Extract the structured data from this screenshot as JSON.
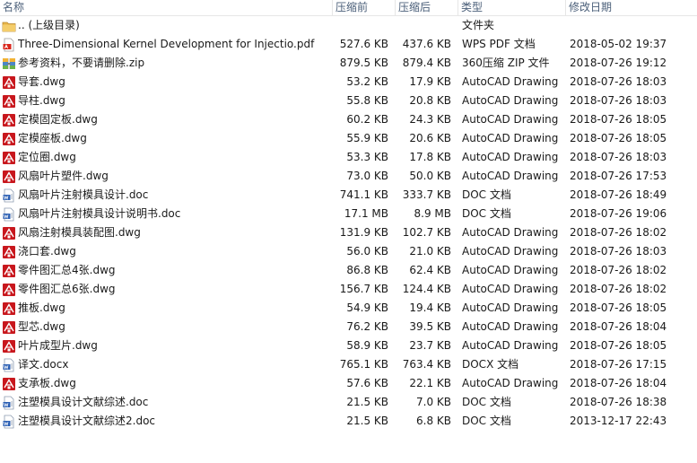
{
  "columns": {
    "name": "名称",
    "compressed": "压缩前",
    "original": "压缩后",
    "type": "类型",
    "modified": "修改日期"
  },
  "rows": [
    {
      "icon": "folder-up-icon",
      "name": ".. (上级目录)",
      "compressed": "",
      "original": "",
      "type": "文件夹",
      "modified": ""
    },
    {
      "icon": "pdf-file-icon",
      "name": "Three-Dimensional Kernel Development for Injectio.pdf",
      "compressed": "527.6 KB",
      "original": "437.6 KB",
      "type": "WPS PDF 文档",
      "modified": "2018-05-02 19:37"
    },
    {
      "icon": "zip-archive-icon",
      "name": "参考资料，不要请删除.zip",
      "compressed": "879.5 KB",
      "original": "879.4 KB",
      "type": "360压缩 ZIP 文件",
      "modified": "2018-07-26 19:12"
    },
    {
      "icon": "dwg-file-icon",
      "name": "导套.dwg",
      "compressed": "53.2 KB",
      "original": "17.9 KB",
      "type": "AutoCAD Drawing",
      "modified": "2018-07-26 18:03"
    },
    {
      "icon": "dwg-file-icon",
      "name": "导柱.dwg",
      "compressed": "55.8 KB",
      "original": "20.8 KB",
      "type": "AutoCAD Drawing",
      "modified": "2018-07-26 18:03"
    },
    {
      "icon": "dwg-file-icon",
      "name": "定模固定板.dwg",
      "compressed": "60.2 KB",
      "original": "24.3 KB",
      "type": "AutoCAD Drawing",
      "modified": "2018-07-26 18:05"
    },
    {
      "icon": "dwg-file-icon",
      "name": "定模座板.dwg",
      "compressed": "55.9 KB",
      "original": "20.6 KB",
      "type": "AutoCAD Drawing",
      "modified": "2018-07-26 18:05"
    },
    {
      "icon": "dwg-file-icon",
      "name": "定位圈.dwg",
      "compressed": "53.3 KB",
      "original": "17.8 KB",
      "type": "AutoCAD Drawing",
      "modified": "2018-07-26 18:03"
    },
    {
      "icon": "dwg-file-icon",
      "name": "风扇叶片塑件.dwg",
      "compressed": "73.0 KB",
      "original": "50.0 KB",
      "type": "AutoCAD Drawing",
      "modified": "2018-07-26 17:53"
    },
    {
      "icon": "doc-file-icon",
      "name": "风扇叶片注射模具设计.doc",
      "compressed": "741.1 KB",
      "original": "333.7 KB",
      "type": "DOC 文档",
      "modified": "2018-07-26 18:49"
    },
    {
      "icon": "doc-file-icon",
      "name": "风扇叶片注射模具设计说明书.doc",
      "compressed": "17.1 MB",
      "original": "8.9 MB",
      "type": "DOC 文档",
      "modified": "2018-07-26 19:06"
    },
    {
      "icon": "dwg-file-icon",
      "name": "风扇注射模具装配图.dwg",
      "compressed": "131.9 KB",
      "original": "102.7 KB",
      "type": "AutoCAD Drawing",
      "modified": "2018-07-26 18:02"
    },
    {
      "icon": "dwg-file-icon",
      "name": "浇口套.dwg",
      "compressed": "56.0 KB",
      "original": "21.0 KB",
      "type": "AutoCAD Drawing",
      "modified": "2018-07-26 18:03"
    },
    {
      "icon": "dwg-file-icon",
      "name": "零件图汇总4张.dwg",
      "compressed": "86.8 KB",
      "original": "62.4 KB",
      "type": "AutoCAD Drawing",
      "modified": "2018-07-26 18:02"
    },
    {
      "icon": "dwg-file-icon",
      "name": "零件图汇总6张.dwg",
      "compressed": "156.7 KB",
      "original": "124.4 KB",
      "type": "AutoCAD Drawing",
      "modified": "2018-07-26 18:02"
    },
    {
      "icon": "dwg-file-icon",
      "name": "推板.dwg",
      "compressed": "54.9 KB",
      "original": "19.4 KB",
      "type": "AutoCAD Drawing",
      "modified": "2018-07-26 18:05"
    },
    {
      "icon": "dwg-file-icon",
      "name": "型芯.dwg",
      "compressed": "76.2 KB",
      "original": "39.5 KB",
      "type": "AutoCAD Drawing",
      "modified": "2018-07-26 18:04"
    },
    {
      "icon": "dwg-file-icon",
      "name": "叶片成型片.dwg",
      "compressed": "58.9 KB",
      "original": "23.7 KB",
      "type": "AutoCAD Drawing",
      "modified": "2018-07-26 18:05"
    },
    {
      "icon": "doc-file-icon",
      "name": "译文.docx",
      "compressed": "765.1 KB",
      "original": "763.4 KB",
      "type": "DOCX 文档",
      "modified": "2018-07-26 17:15"
    },
    {
      "icon": "dwg-file-icon",
      "name": "支承板.dwg",
      "compressed": "57.6 KB",
      "original": "22.1 KB",
      "type": "AutoCAD Drawing",
      "modified": "2018-07-26 18:04"
    },
    {
      "icon": "doc-file-icon",
      "name": "注塑模具设计文献综述.doc",
      "compressed": "21.5 KB",
      "original": "7.0 KB",
      "type": "DOC 文档",
      "modified": "2018-07-26 18:38"
    },
    {
      "icon": "doc-file-icon",
      "name": "注塑模具设计文献综述2.doc",
      "compressed": "21.5 KB",
      "original": "6.8 KB",
      "type": "DOC 文档",
      "modified": "2013-12-17 22:43"
    }
  ]
}
